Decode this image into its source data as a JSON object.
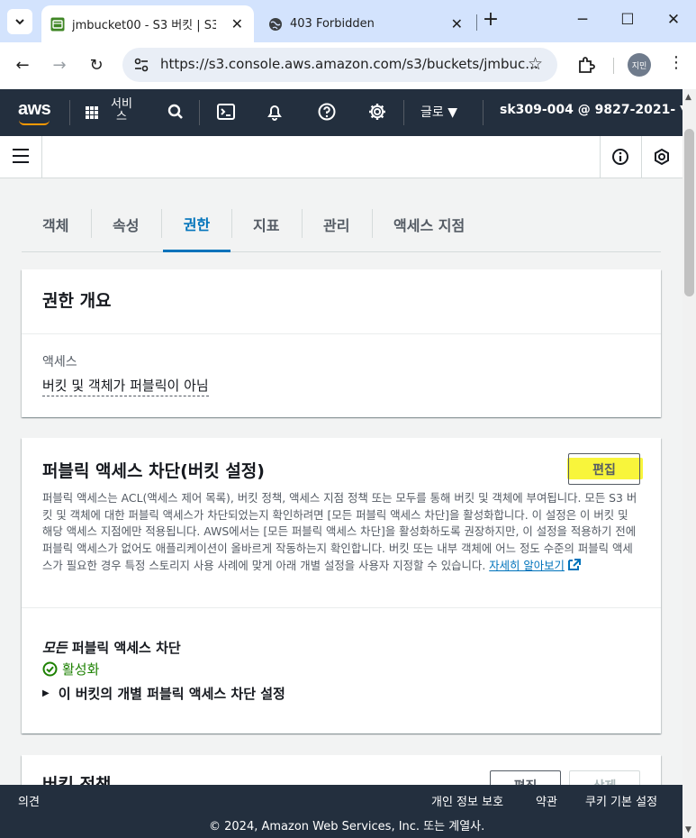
{
  "browser": {
    "tabs": [
      {
        "title": "jmbucket00 - S3 버킷 | S3",
        "active": true
      },
      {
        "title": "403 Forbidden",
        "active": false
      }
    ],
    "url": "https://s3.console.aws.amazon.com/s3/buckets/jmbuc...",
    "profile_initials": "지민"
  },
  "aws_header": {
    "logo": "aws",
    "services_label": "서비스",
    "region": "글로 ▼",
    "account": "sk309-004 @ 9827-2021-  ▼"
  },
  "content_tabs": [
    "객체",
    "속성",
    "권한",
    "지표",
    "관리",
    "액세스 지점"
  ],
  "active_tab": "권한",
  "overview": {
    "title": "권한 개요",
    "access_label": "액세스",
    "access_value": "버킷 및 객체가 퍼블릭이 아님"
  },
  "block_public": {
    "title": "퍼블릭 액세스 차단(버킷 설정)",
    "edit_label": "편집",
    "description": "퍼블릭 액세스는 ACL(액세스 제어 목록), 버킷 정책, 액세스 지점 정책 또는 모두를 통해 버킷 및 객체에 부여됩니다. 모든 S3 버킷 및 객체에 대한 퍼블릭 액세스가 차단되었는지 확인하려면 [모든 퍼블릭 액세스 차단]을 활성화합니다. 이 설정은 이 버킷 및 해당 액세스 지점에만 적용됩니다. AWS에서는 [모든 퍼블릭 액세스 차단]을 활성화하도록 권장하지만, 이 설정을 적용하기 전에 퍼블릭 액세스가 없어도 애플리케이션이 올바르게 작동하는지 확인합니다. 버킷 또는 내부 객체에 어느 정도 수준의 퍼블릭 액세스가 필요한 경우 특정 스토리지 사용 사례에 맞게 아래 개별 설정을 사용자 지정할 수 있습니다.",
    "learn_more": "자세히 알아보기",
    "all_block_prefix": "모든",
    "all_block_suffix": " 퍼블릭 액세스 차단",
    "status": "활성화",
    "expand_label": "이 버킷의 개별 퍼블릭 액세스 차단 설정"
  },
  "bucket_policy": {
    "title": "버킷 정책",
    "edit_label": "편집",
    "delete_label": "삭제"
  },
  "footer": {
    "feedback": "의견",
    "privacy": "개인 정보 보호",
    "terms": "약관",
    "cookies": "쿠키 기본 설정",
    "copyright": "© 2024, Amazon Web Services, Inc. 또는 계열사."
  },
  "colors": {
    "aws_nav": "#232f3e",
    "aws_orange": "#ff9900",
    "link_blue": "#0073bb",
    "success_green": "#1d8102",
    "highlight_yellow": "#f8f53b"
  }
}
